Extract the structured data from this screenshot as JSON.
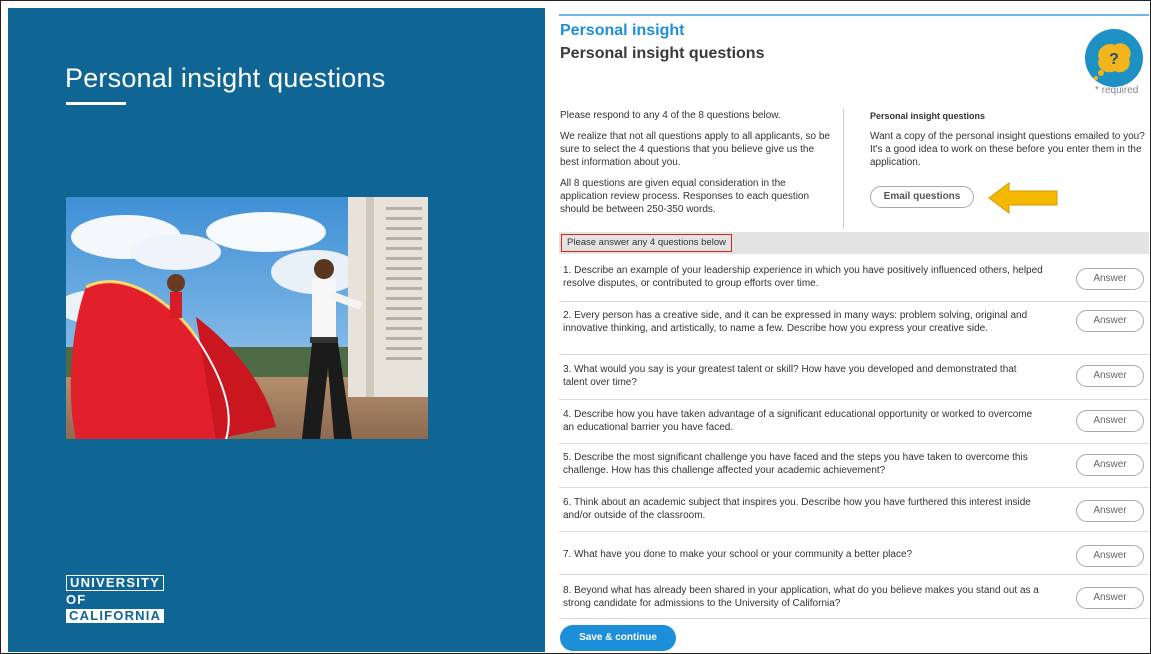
{
  "left_panel": {
    "title": "Personal insight questions",
    "photo_icon": "dancers-photo",
    "logo": {
      "line1": "UNIVERSITY",
      "line2": "OF",
      "line3": "CALIFORNIA"
    },
    "colors": {
      "background": "#0f6593",
      "text": "#ffffff"
    }
  },
  "header": {
    "section": "Personal insight",
    "title": "Personal insight questions",
    "badge_icon": "question-bubble-icon",
    "required": "* required"
  },
  "intro": {
    "p1": "Please respond to any 4 of the 8 questions below.",
    "p2": "We realize that not all questions apply to all applicants, so be sure to select the 4 questions that you believe give us the best information about you.",
    "p3": "All 8 questions are given equal consideration in the application review process. Responses to each question should be between 250-350 words."
  },
  "side": {
    "heading": "Personal insight questions",
    "text": "Want a copy of the personal insight questions emailed to you? It's a good idea to work on these before you enter them in the application.",
    "email_button": "Email questions",
    "arrow_icon": "arrow-left-icon"
  },
  "questions_header": "Please answer any 4 questions below",
  "questions": [
    {
      "text": "1. Describe an example of your leadership experience in which you have positively influenced others, helped resolve disputes, or contributed to group efforts over time.",
      "button": "Answer"
    },
    {
      "text": "2. Every person has a creative side, and it can be expressed in many ways: problem solving, original and innovative thinking, and artistically, to name a few. Describe how you express your creative side.",
      "button": "Answer"
    },
    {
      "text": "3. What would you say is your greatest talent or skill? How have you developed and demonstrated that talent over time?",
      "button": "Answer"
    },
    {
      "text": "4. Describe how you have taken advantage of a significant educational opportunity or worked to overcome an educational barrier you have faced.",
      "button": "Answer"
    },
    {
      "text": "5. Describe the most significant challenge you have faced and the steps you have taken to overcome this challenge. How has this challenge affected your academic achievement?",
      "button": "Answer"
    },
    {
      "text": "6. Think about an academic subject that inspires you. Describe how you have furthered this interest inside and/or outside of the classroom.",
      "button": "Answer"
    },
    {
      "text": "7. What have you done to make your school or your community a better place?",
      "button": "Answer"
    },
    {
      "text": "8. Beyond what has already been shared in your application, what do you believe makes you stand out as a strong candidate for admissions to the University of California?",
      "button": "Answer"
    }
  ],
  "save_button": "Save & continue",
  "colors": {
    "accent": "#1d8fd8",
    "highlight_border": "#e02020",
    "arrow": "#f5b800"
  }
}
